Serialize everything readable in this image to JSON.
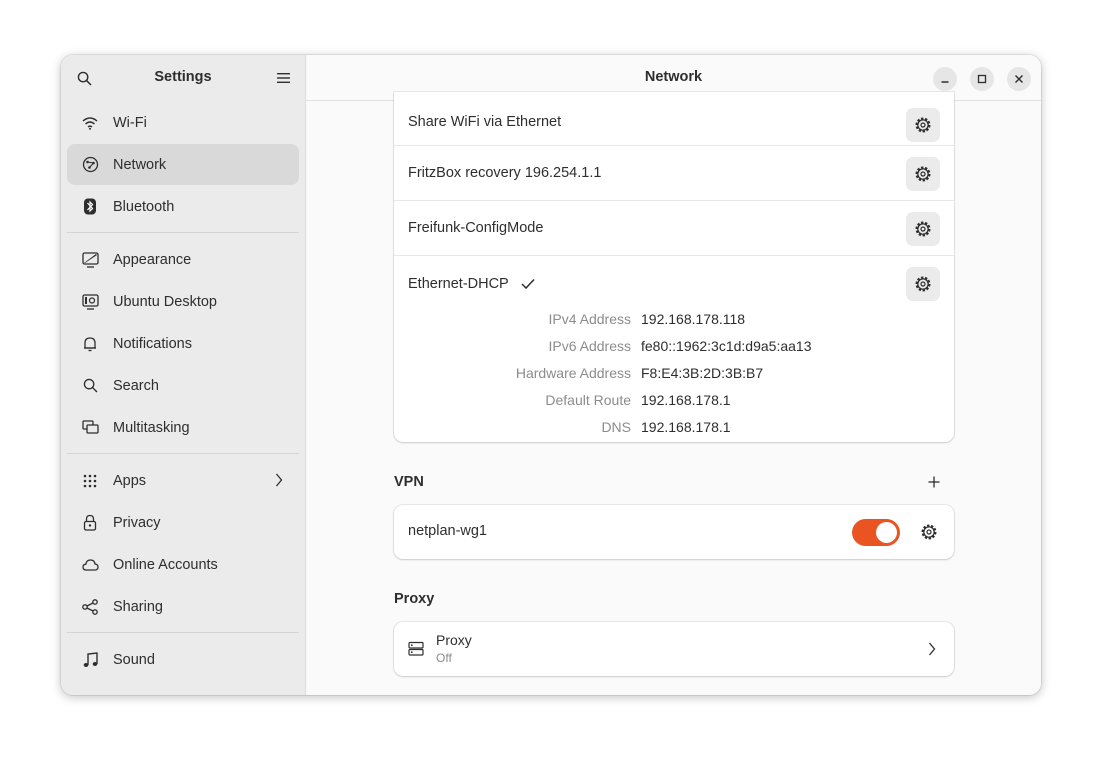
{
  "colors": {
    "accent": "#e95420",
    "sidebar_bg": "#ebebeb",
    "active_item": "#d9d9d9"
  },
  "sidebar": {
    "title": "Settings",
    "search_icon": "search-icon",
    "menu_icon": "hamburger-menu-icon",
    "items": [
      {
        "label": "Wi-Fi",
        "icon": "wifi-icon"
      },
      {
        "label": "Network",
        "icon": "network-icon",
        "active": true
      },
      {
        "label": "Bluetooth",
        "icon": "bluetooth-icon"
      },
      {
        "label": "Appearance",
        "icon": "appearance-icon"
      },
      {
        "label": "Ubuntu Desktop",
        "icon": "ubuntu-desktop-icon"
      },
      {
        "label": "Notifications",
        "icon": "bell-icon"
      },
      {
        "label": "Search",
        "icon": "search-icon"
      },
      {
        "label": "Multitasking",
        "icon": "multitasking-icon"
      },
      {
        "label": "Apps",
        "icon": "apps-grid-icon"
      },
      {
        "label": "Privacy",
        "icon": "lock-icon"
      },
      {
        "label": "Online Accounts",
        "icon": "cloud-icon"
      },
      {
        "label": "Sharing",
        "icon": "share-icon"
      },
      {
        "label": "Sound",
        "icon": "music-note-icon"
      }
    ]
  },
  "header": {
    "title": "Network"
  },
  "connections": [
    {
      "name": "Share WiFi via Ethernet"
    },
    {
      "name": "FritzBox recovery 196.254.1.1"
    },
    {
      "name": "Freifunk-ConfigMode"
    }
  ],
  "ethernet": {
    "name": "Ethernet-DHCP",
    "details": [
      {
        "label": "IPv4 Address",
        "value": "192.168.178.118"
      },
      {
        "label": "IPv6 Address",
        "value": "fe80::1962:3c1d:d9a5:aa13"
      },
      {
        "label": "Hardware Address",
        "value": "F8:E4:3B:2D:3B:B7"
      },
      {
        "label": "Default Route",
        "value": "192.168.178.1"
      },
      {
        "label": "DNS",
        "value": "192.168.178.1"
      }
    ]
  },
  "vpn": {
    "title": "VPN",
    "connection": {
      "name": "netplan-wg1",
      "enabled": true
    }
  },
  "proxy": {
    "title": "Proxy",
    "row_title": "Proxy",
    "row_status": "Off"
  }
}
